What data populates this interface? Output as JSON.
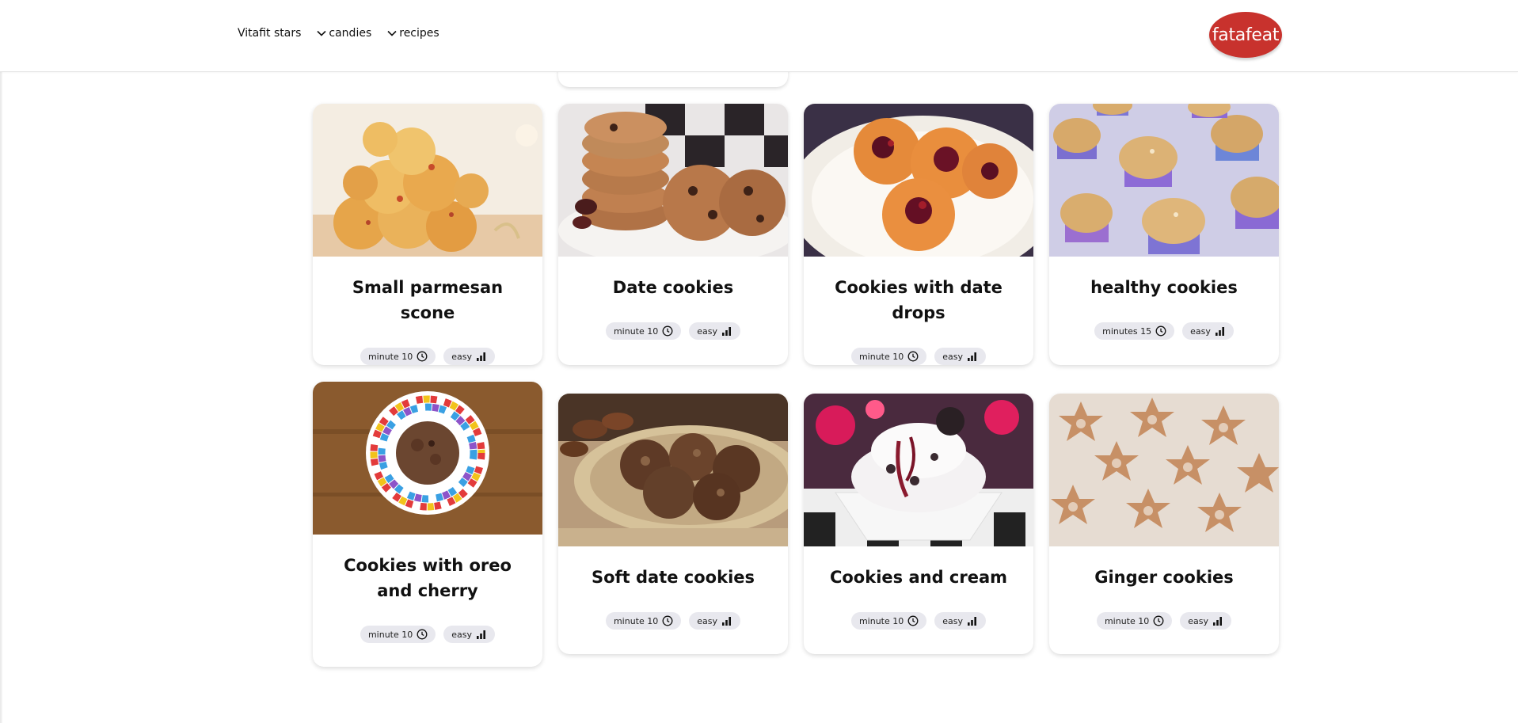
{
  "nav": {
    "items": [
      {
        "label": "Vitafit stars",
        "has_dropdown": false
      },
      {
        "label": "candies",
        "has_dropdown": true
      },
      {
        "label": "recipes",
        "has_dropdown": true
      }
    ],
    "logo_text": "fatafeat"
  },
  "brand_color": "#c8322d",
  "cards": [
    {
      "title": "Small parmesan scone",
      "time": "minute 10",
      "difficulty": "easy"
    },
    {
      "title": "Date cookies",
      "time": "minute 10",
      "difficulty": "easy"
    },
    {
      "title": "Cookies with date drops",
      "time": "minute 10",
      "difficulty": "easy"
    },
    {
      "title": "healthy cookies",
      "time": "minutes 15",
      "difficulty": "easy"
    },
    {
      "title": "Cookies with oreo and cherry",
      "time": "minute 10",
      "difficulty": "easy"
    },
    {
      "title": "Soft date cookies",
      "time": "minute 10",
      "difficulty": "easy"
    },
    {
      "title": "Cookies and cream",
      "time": "minute 10",
      "difficulty": "easy"
    },
    {
      "title": "Ginger cookies",
      "time": "minute 10",
      "difficulty": "easy"
    }
  ],
  "icons": {
    "time": "clock-icon",
    "difficulty": "signal-bars-icon",
    "dropdown": "chevron-down-icon"
  }
}
